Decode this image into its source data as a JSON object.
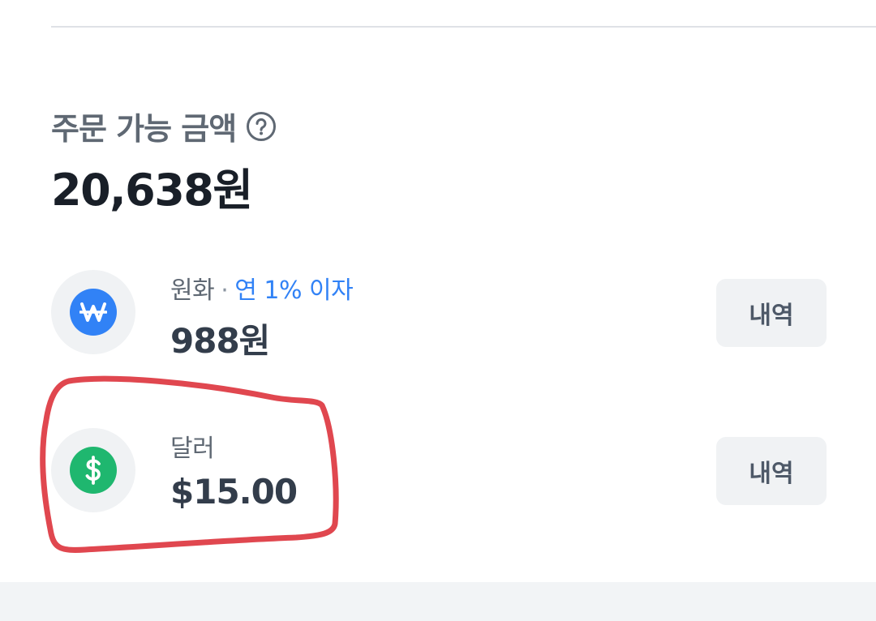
{
  "header": {
    "title": "주문 가능 금액",
    "help_icon": "question-circle-icon",
    "total_amount": "20,638원"
  },
  "accounts": [
    {
      "icon": "won-icon",
      "icon_glyph": "₩",
      "icon_color": "#3182f6",
      "label": "원화",
      "separator": "·",
      "interest": "연 1% 이자",
      "amount": "988원",
      "button_label": "내역"
    },
    {
      "icon": "dollar-icon",
      "icon_glyph": "$",
      "icon_color": "#1fb76f",
      "label": "달러",
      "amount": "$15.00",
      "button_label": "내역"
    }
  ],
  "colors": {
    "accent_blue": "#3182f6",
    "accent_green": "#1fb76f",
    "annotation_red": "#e0474f"
  }
}
